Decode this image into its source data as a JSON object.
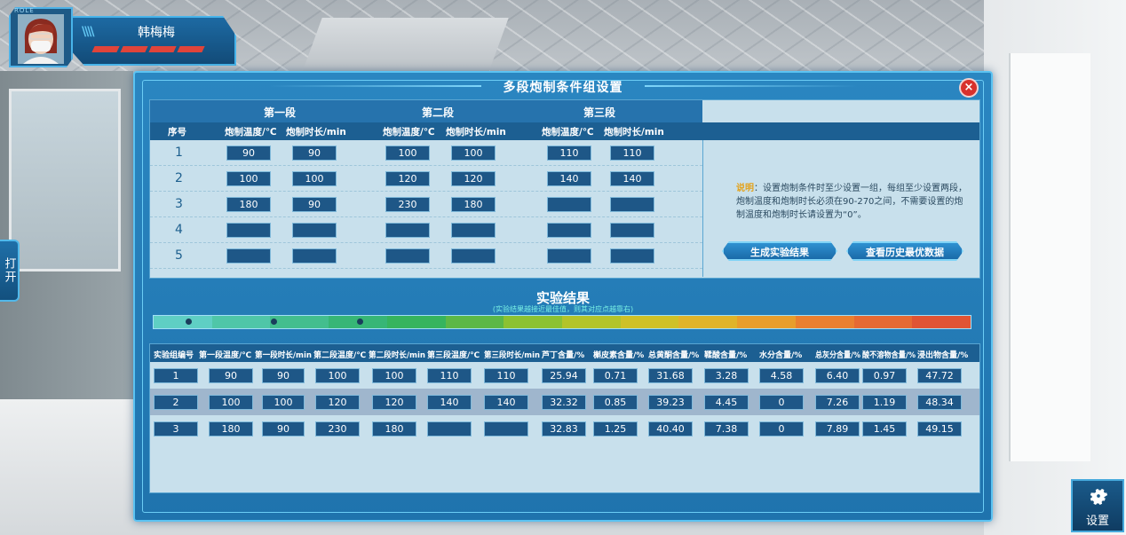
{
  "profile": {
    "role_tag": "ROLE",
    "name": "韩梅梅",
    "health_segments": 4
  },
  "side_tab": {
    "label": "打开"
  },
  "settings": {
    "label": "设置",
    "icon": "gear-icon"
  },
  "dialog": {
    "title": "多段炮制条件组设置",
    "close_icon": "close-icon"
  },
  "conditions": {
    "stages": [
      "第一段",
      "第二段",
      "第三段"
    ],
    "columns": {
      "index": "序号",
      "temp1": "炮制温度/℃",
      "time1": "炮制时长/min",
      "temp2": "炮制温度/℃",
      "time2": "炮制时长/min",
      "temp3": "炮制温度/℃",
      "time3": "炮制时长/min"
    },
    "rows": [
      {
        "idx": "1",
        "t1": "90",
        "d1": "90",
        "t2": "100",
        "d2": "100",
        "t3": "110",
        "d3": "110"
      },
      {
        "idx": "2",
        "t1": "100",
        "d1": "100",
        "t2": "120",
        "d2": "120",
        "t3": "140",
        "d3": "140"
      },
      {
        "idx": "3",
        "t1": "180",
        "d1": "90",
        "t2": "230",
        "d2": "180",
        "t3": "",
        "d3": ""
      },
      {
        "idx": "4",
        "t1": "",
        "d1": "",
        "t2": "",
        "d2": "",
        "t3": "",
        "d3": ""
      },
      {
        "idx": "5",
        "t1": "",
        "d1": "",
        "t2": "",
        "d2": "",
        "t3": "",
        "d3": ""
      }
    ],
    "note_key": "说明",
    "note_text": "：设置炮制条件时至少设置一组，每组至少设置两段，炮制温度和炮制时长必须在90-270之间，不需要设置的炮制温度和炮制时长请设置为“0”。",
    "btn_generate": "生成实验结果",
    "btn_history": "查看历史最优数据"
  },
  "results": {
    "title": "实验结果",
    "subtitle": "(实验结果越接近最佳值，则其对应点越靠右)",
    "gradient_colors": [
      "#5fcfc4",
      "#4fc6a8",
      "#43be8e",
      "#37b676",
      "#36b45e",
      "#5cb847",
      "#8cc232",
      "#b3c42a",
      "#cfc127",
      "#e0b42a",
      "#e89e2c",
      "#ea8030",
      "#e66a33",
      "#e05434"
    ],
    "markers": [
      0.04,
      0.145,
      0.25
    ],
    "columns": [
      "实验组编号",
      "第一段温度/℃",
      "第一段时长/min",
      "第二段温度/℃",
      "第二段时长/min",
      "第三段温度/℃",
      "第三段时长/min",
      "芦丁含量/%",
      "槲皮素含量/%",
      "总黄酮含量/%",
      "鞣酸含量/%",
      "水分含量/%",
      "总灰分含量/%",
      "酸不溶物含量/%",
      "浸出物含量/%"
    ],
    "rows": [
      [
        "1",
        "90",
        "90",
        "100",
        "100",
        "110",
        "110",
        "25.94",
        "0.71",
        "31.68",
        "3.28",
        "4.58",
        "6.40",
        "0.97",
        "47.72"
      ],
      [
        "2",
        "100",
        "100",
        "120",
        "120",
        "140",
        "140",
        "32.32",
        "0.85",
        "39.23",
        "4.45",
        "0",
        "7.26",
        "1.19",
        "48.34"
      ],
      [
        "3",
        "180",
        "90",
        "230",
        "180",
        "",
        "",
        "32.83",
        "1.25",
        "40.40",
        "7.38",
        "0",
        "7.89",
        "1.45",
        "49.15"
      ]
    ]
  }
}
